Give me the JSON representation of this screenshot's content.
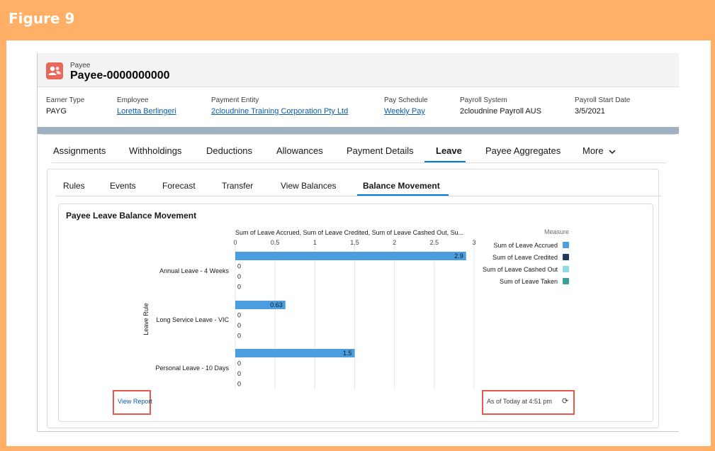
{
  "figure_title": "Figure 9",
  "record": {
    "object_label": "Payee",
    "name": "Payee-0000000000"
  },
  "fields": [
    {
      "label": "Earner Type",
      "value": "PAYG",
      "link": false
    },
    {
      "label": "Employee",
      "value": "Loretta Berlingeri",
      "link": true
    },
    {
      "label": "Payment Entity",
      "value": "2cloudnine Training Corporation Pty Ltd",
      "link": true
    },
    {
      "label": "Pay Schedule",
      "value": "Weekly Pay",
      "link": true
    },
    {
      "label": "Payroll System",
      "value": "2cloudnine Payroll AUS",
      "link": false
    },
    {
      "label": "Payroll Start Date",
      "value": "3/5/2021",
      "link": false
    }
  ],
  "tabs": [
    "Assignments",
    "Withholdings",
    "Deductions",
    "Allowances",
    "Payment Details",
    "Leave",
    "Payee Aggregates",
    "More"
  ],
  "active_tab": "Leave",
  "leave_tabs": [
    "Rules",
    "Events",
    "Forecast",
    "Transfer",
    "View Balances",
    "Balance Movement"
  ],
  "active_leave_tab": "Balance Movement",
  "report": {
    "title": "Payee Leave Balance Movement",
    "view_report_label": "View Report",
    "as_of_label": "As of Today at 4:51 pm"
  },
  "icons": {
    "record": "payee-icon",
    "more": "chevron-down-icon",
    "refresh": "refresh-icon"
  },
  "colors": {
    "accent": "#0176d3",
    "record_icon": "#e8685e",
    "highlight_box": "#e8584c",
    "frame": "#ffb066"
  },
  "chart_data": {
    "type": "bar",
    "orientation": "horizontal",
    "title": "Sum of Leave Accrued, Sum of Leave Credited, Sum of Leave Cashed Out, Su...",
    "ylabel": "Leave Rule",
    "xlim": [
      0,
      3
    ],
    "x_ticks": [
      "0",
      "0.5",
      "1",
      "1.5",
      "2",
      "2.5",
      "3"
    ],
    "categories": [
      "Annual Leave - 4 Weeks",
      "Long Service Leave - VIC",
      "Personal Leave - 10 Days"
    ],
    "legend_title": "Measure",
    "legend_position": "right",
    "series": [
      {
        "name": "Sum of Leave Accrued",
        "color": "#4a9ee0",
        "values": [
          2.9,
          0.63,
          1.5
        ],
        "labels": [
          "2.9",
          "0.63",
          "1.5"
        ]
      },
      {
        "name": "Sum of Leave Credited",
        "color": "#1e3a5f",
        "values": [
          0,
          0,
          0
        ],
        "labels": [
          "0",
          "0",
          "0"
        ]
      },
      {
        "name": "Sum of Leave Cashed Out",
        "color": "#90d9e2",
        "values": [
          0,
          0,
          0
        ],
        "labels": [
          "0",
          "0",
          "0"
        ]
      },
      {
        "name": "Sum of Leave Taken",
        "color": "#3aa096",
        "values": [
          0,
          0,
          0
        ],
        "labels": [
          "0",
          "0",
          "0"
        ]
      }
    ]
  }
}
